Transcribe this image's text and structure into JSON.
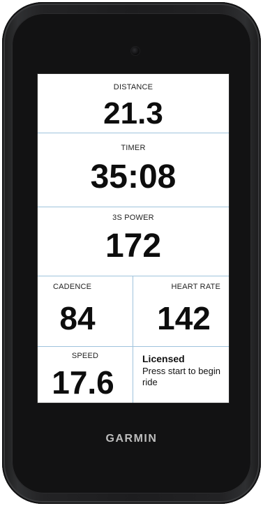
{
  "fields": {
    "distance": {
      "label": "DISTANCE",
      "value": "21.3"
    },
    "timer": {
      "label": "TIMER",
      "value": "35:08"
    },
    "power": {
      "label": "3S POWER",
      "value": "172"
    },
    "cadence": {
      "label": "CADENCE",
      "value": "84"
    },
    "heart_rate": {
      "label": "HEART RATE",
      "value": "142"
    },
    "speed": {
      "label": "SPEED",
      "value": "17.6"
    }
  },
  "notice": {
    "title": "Licensed",
    "message": "Press start to begin ride"
  },
  "brand": "GARMIN",
  "colors": {
    "divider": "#9fc3dc",
    "device_body": "#1d1d1f",
    "screen_bg": "#ffffff",
    "value_text": "#0d0d0d",
    "brand_text": "#bdbdbd"
  }
}
